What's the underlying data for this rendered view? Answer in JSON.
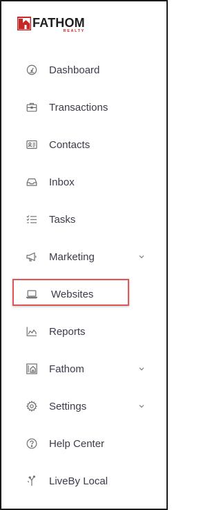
{
  "brand": {
    "name": "FATHOM",
    "sub": "REALTY",
    "accent_color": "#c62828",
    "icon": "fathom-logo-icon"
  },
  "nav": {
    "items": [
      {
        "label": "Dashboard",
        "icon": "gauge-icon",
        "has_chevron": false
      },
      {
        "label": "Transactions",
        "icon": "briefcase-icon",
        "has_chevron": false
      },
      {
        "label": "Contacts",
        "icon": "contact-card-icon",
        "has_chevron": false
      },
      {
        "label": "Inbox",
        "icon": "inbox-tray-icon",
        "has_chevron": false
      },
      {
        "label": "Tasks",
        "icon": "checklist-icon",
        "has_chevron": false
      },
      {
        "label": "Marketing",
        "icon": "megaphone-icon",
        "has_chevron": true
      },
      {
        "label": "Websites",
        "icon": "laptop-icon",
        "has_chevron": false,
        "highlighted": true
      },
      {
        "label": "Reports",
        "icon": "area-chart-icon",
        "has_chevron": false
      },
      {
        "label": "Fathom",
        "icon": "fathom-building-icon",
        "has_chevron": true
      },
      {
        "label": "Settings",
        "icon": "gear-icon",
        "has_chevron": true
      },
      {
        "label": "Help Center",
        "icon": "help-circle-icon",
        "has_chevron": false
      },
      {
        "label": "LiveBy Local",
        "icon": "map-pin-icon",
        "has_chevron": false
      }
    ]
  },
  "colors": {
    "highlight_border": "#e05555",
    "text": "#3b3b4a",
    "icon": "#6f6f6f"
  }
}
